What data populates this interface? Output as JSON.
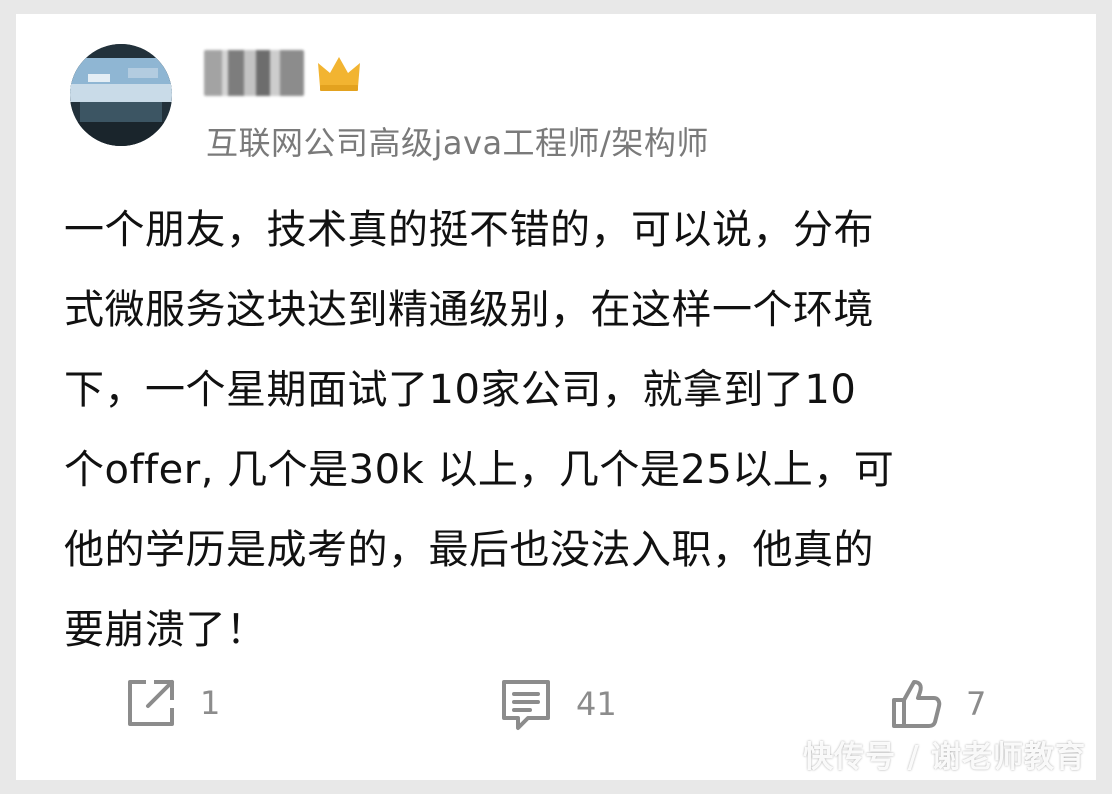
{
  "post": {
    "author": {
      "avatar_icon": "avatar-photo",
      "badge_icon": "crown-icon",
      "title": "互联网公司高级java工程师/架构师"
    },
    "content_lines": [
      "一个朋友，技术真的挺不错的，可以说，分布",
      "式微服务这块达到精通级别，在这样一个环境",
      "下，一个星期面试了10家公司，就拿到了10",
      "个offer, 几个是30k 以上，几个是25以上，可",
      "他的学历是成考的，最后也没法入职，他真的",
      "要崩溃了！"
    ],
    "actions": {
      "share": {
        "icon": "share-icon",
        "count": "1"
      },
      "comment": {
        "icon": "comment-icon",
        "count": "41"
      },
      "like": {
        "icon": "thumbs-up-icon",
        "count": "7"
      }
    }
  },
  "watermark": "快传号 / 谢老师教育",
  "colors": {
    "background": "#e8e8e8",
    "card": "#ffffff",
    "text": "#111111",
    "muted": "#7a7a7a",
    "icon": "#8c8c8c",
    "crown": "#f2b431"
  }
}
